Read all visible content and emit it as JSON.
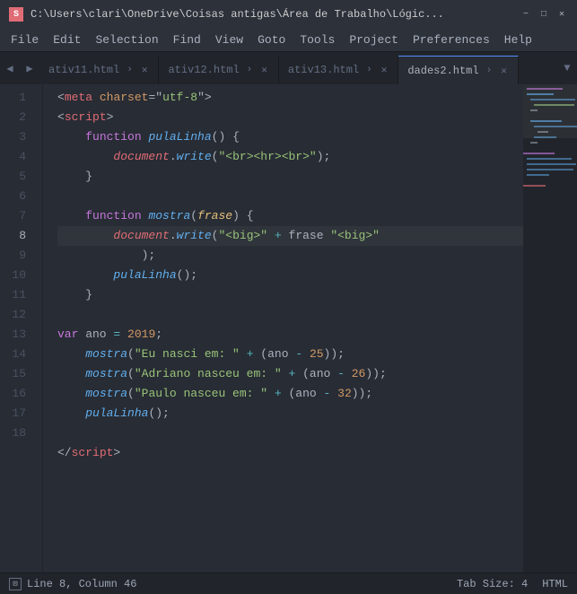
{
  "titleBar": {
    "path": "C:\\Users\\clari\\OneDrive\\Coisas antigas\\Área de Trabalho\\Lógic...",
    "appIcon": "S",
    "minBtn": "−",
    "maxBtn": "□",
    "closeBtn": "✕"
  },
  "menuBar": {
    "items": [
      "File",
      "Edit",
      "Selection",
      "Find",
      "View",
      "Goto",
      "Tools",
      "Project",
      "Preferences",
      "Help"
    ]
  },
  "tabs": [
    {
      "label": "ativ11.html",
      "active": false
    },
    {
      "label": "ativ12.html",
      "active": false
    },
    {
      "label": "ativ13.html",
      "active": false
    },
    {
      "label": "dades2.html",
      "active": true
    }
  ],
  "statusBar": {
    "lineCol": "Line 8, Column 46",
    "tabSize": "Tab Size: 4",
    "language": "HTML"
  },
  "lineNumbers": [
    1,
    2,
    3,
    4,
    5,
    6,
    7,
    8,
    9,
    10,
    11,
    12,
    13,
    14,
    15,
    16,
    17,
    18
  ],
  "activeLine": 8
}
